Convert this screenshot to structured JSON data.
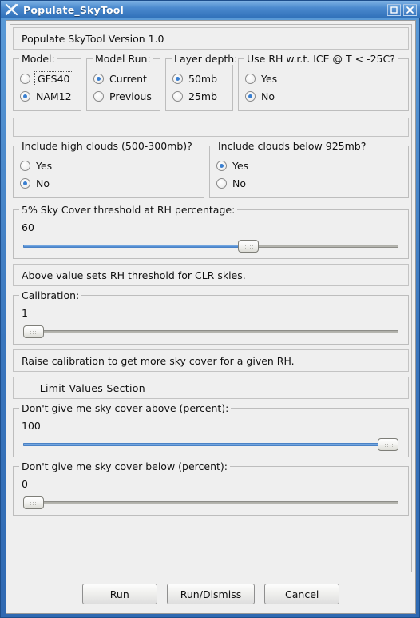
{
  "window": {
    "title": "Populate_SkyTool",
    "icon": "xterm-x-icon",
    "maximize_label": "maximize-icon",
    "close_label": "close-icon",
    "titlebar_color": "#3a77c0",
    "frame_color": "#2f69b2",
    "background_color": "#efefef"
  },
  "version_panel": {
    "text": "Populate SkyTool Version 1.0"
  },
  "groups": {
    "model": {
      "legend": "Model:",
      "options": [
        {
          "label": "GFS40",
          "selected": false,
          "focused": true
        },
        {
          "label": "NAM12",
          "selected": true,
          "focused": false
        }
      ]
    },
    "model_run": {
      "legend": "Model Run:",
      "options": [
        {
          "label": "Current",
          "selected": true,
          "focused": false
        },
        {
          "label": "Previous",
          "selected": false,
          "focused": false
        }
      ]
    },
    "layer_depth": {
      "legend": "Layer depth:",
      "options": [
        {
          "label": "50mb",
          "selected": true,
          "focused": false
        },
        {
          "label": "25mb",
          "selected": false,
          "focused": false
        }
      ]
    },
    "use_rh_ice": {
      "legend": "Use RH w.r.t. ICE @ T < -25C?",
      "options": [
        {
          "label": "Yes",
          "selected": false,
          "focused": false
        },
        {
          "label": "No",
          "selected": true,
          "focused": false
        }
      ]
    },
    "high_clouds": {
      "legend": "Include high clouds (500-300mb)?",
      "options": [
        {
          "label": "Yes",
          "selected": false,
          "focused": false
        },
        {
          "label": "No",
          "selected": true,
          "focused": false
        }
      ]
    },
    "clouds_below": {
      "legend": "Include clouds below 925mb?",
      "options": [
        {
          "label": "Yes",
          "selected": true,
          "focused": false
        },
        {
          "label": "No",
          "selected": false,
          "focused": false
        }
      ]
    }
  },
  "blank_panel": {
    "text": ""
  },
  "sliders": {
    "sky_cover_threshold": {
      "legend": "5% Sky Cover threshold at RH percentage:",
      "value": "60",
      "percent": 60,
      "filled": true
    },
    "calibration": {
      "legend": "Calibration:",
      "value": "1",
      "percent": 0,
      "filled": false
    },
    "sky_cover_above": {
      "legend": "Don't give me sky cover above (percent):",
      "value": "100",
      "percent": 100,
      "filled": true
    },
    "sky_cover_below": {
      "legend": "Don't give me sky cover below (percent):",
      "value": "0",
      "percent": 0,
      "filled": false
    }
  },
  "notes": {
    "clr_note": "Above value sets RH threshold for CLR skies.",
    "calibration_note": "Raise calibration to get more sky cover for a given RH.",
    "limit_section": "---   Limit Values Section   ---"
  },
  "buttons": {
    "run": "Run",
    "run_dismiss": "Run/Dismiss",
    "cancel": "Cancel"
  }
}
